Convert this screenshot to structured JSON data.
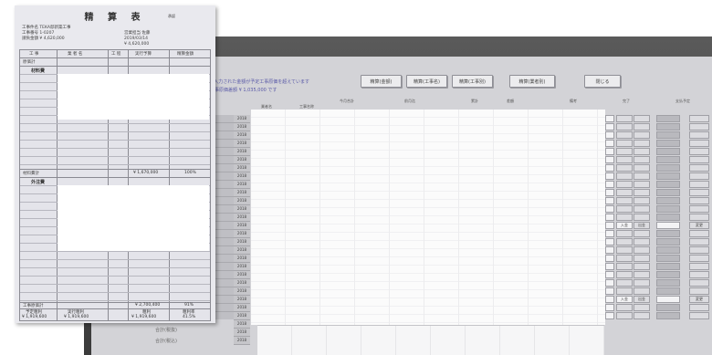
{
  "screen": {
    "info_line_1": "※入力された金額が予定工事原価を超えています",
    "info_line_2": "工事原価差額 ¥ 1,035,000 です",
    "buttons": [
      "精算(金額)",
      "精算(工事名)",
      "精算(工事別)",
      "精算(業者別)",
      "閉じる"
    ],
    "col_headers": [
      "業者名",
      "工事名称",
      "今月合計",
      "前月迄",
      "累計",
      "差額",
      "備考",
      "完了",
      "支払予定"
    ],
    "row_code": "2018",
    "row_count": 28,
    "right_cells": [
      "入金",
      "出金",
      "変更"
    ],
    "bottom_labels": [
      "合計(税抜)",
      "合計(税込)"
    ]
  },
  "paper": {
    "title": "精 算 表",
    "seal": "承認",
    "info_left": [
      "工事件名 TEKA邸新築工事",
      "工事番号 1-0207",
      "請負金額 ¥ 4,620,000"
    ],
    "info_right": [
      "営業担当 佐藤",
      "2019/03/14",
      "¥ 4,620,000"
    ],
    "headers": [
      "工 事",
      "業 者 名",
      "工 程",
      "実行予算",
      "精算金額"
    ],
    "row_label_1": "原価計",
    "section_a": "材料費",
    "section_b": "外注費",
    "subtotal_label": "材料費計",
    "subtotal_value": "¥ 1,670,000",
    "subtotal_rate": "100%",
    "total_label": "工事原価計",
    "total_value": "¥ 2,700,400",
    "total_rate": "91%",
    "footer_headers": [
      "予定粗利",
      "実行粗利",
      "粗利",
      "粗利率"
    ],
    "footer_values": [
      "¥ 1,919,600",
      "¥ 1,919,600",
      "¥ 1,919,600",
      "41.5%"
    ]
  }
}
